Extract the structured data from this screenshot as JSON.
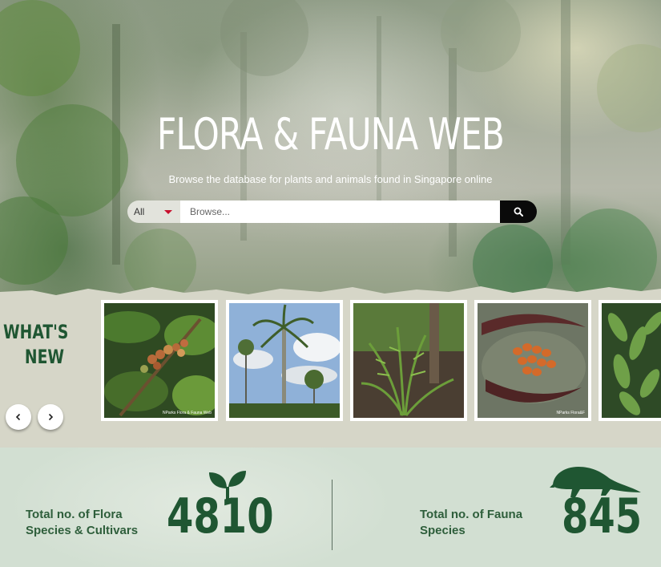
{
  "hero": {
    "title": "FLORA & FAUNA WEB",
    "subtitle": "Browse the database for plants and animals found in Singapore online",
    "search": {
      "category_selected": "All",
      "placeholder": "Browse...",
      "button_icon": "search-icon"
    }
  },
  "whats_new": {
    "title_line1": "WHAT'S",
    "title_line2": "NEW",
    "prev_icon": "chevron-left-icon",
    "next_icon": "chevron-right-icon",
    "items": [
      {
        "credit": "NParks Flora & Fauna Web"
      },
      {
        "credit": ""
      },
      {
        "credit": ""
      },
      {
        "credit": "NParks Flora&F"
      },
      {
        "credit": ""
      }
    ]
  },
  "stats": {
    "flora": {
      "label_line1": "Total no. of Flora",
      "label_line2": "Species & Cultivars",
      "count": "4810",
      "icon": "sprout-icon"
    },
    "fauna": {
      "label_line1": "Total no. of Fauna",
      "label_line2": "Species",
      "count": "845",
      "icon": "pangolin-icon"
    }
  },
  "colors": {
    "brand_green": "#1f5632",
    "label_green": "#2e5e3b",
    "dropdown_caret": "#c8102e"
  }
}
